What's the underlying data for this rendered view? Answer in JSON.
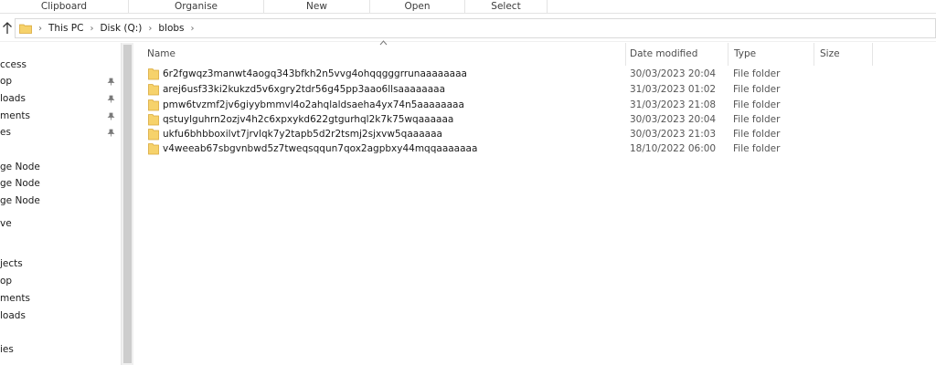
{
  "ribbon": {
    "groups": [
      "Clipboard",
      "Organise",
      "New",
      "Open",
      "Select"
    ]
  },
  "address": {
    "crumbs": [
      "This PC",
      "Disk (Q:)",
      "blobs"
    ],
    "separator": "›",
    "trailing_separator": "›"
  },
  "nav": {
    "items": [
      {
        "label": "ccess",
        "pinned": false
      },
      {
        "label": "op",
        "pinned": true
      },
      {
        "label": "loads",
        "pinned": true
      },
      {
        "label": "ments",
        "pinned": true
      },
      {
        "label": "es",
        "pinned": true
      },
      {
        "label": "ge Node",
        "pinned": false
      },
      {
        "label": "ge Node",
        "pinned": false
      },
      {
        "label": "ge Node",
        "pinned": false
      },
      {
        "label": "ve",
        "pinned": false
      },
      {
        "label": "jects",
        "pinned": false
      },
      {
        "label": "op",
        "pinned": false
      },
      {
        "label": "ments",
        "pinned": false
      },
      {
        "label": "loads",
        "pinned": false
      },
      {
        "label": "ies",
        "pinned": false
      }
    ]
  },
  "columns": {
    "name": "Name",
    "date": "Date modified",
    "type": "Type",
    "size": "Size"
  },
  "files": [
    {
      "name": "6r2fgwqz3manwt4aogq343bfkh2n5vvg4ohqqgggrrunaaaaaaaa",
      "date": "30/03/2023 20:04",
      "type": "File folder"
    },
    {
      "name": "arej6usf33ki2kukzd5v6xgry2tdr56g45pp3aao6llsaaaaaaaa",
      "date": "31/03/2023 01:02",
      "type": "File folder"
    },
    {
      "name": "pmw6tvzmf2jv6giyybmmvl4o2ahqlaldsaeha4yx74n5aaaaaaaa",
      "date": "31/03/2023 21:08",
      "type": "File folder"
    },
    {
      "name": "qstuylguhrn2ozjv4h2c6xpxykd622gtgurhql2k7k75wqaaaaaa",
      "date": "30/03/2023 20:04",
      "type": "File folder"
    },
    {
      "name": "ukfu6bhbboxilvt7jrvlqk7y2tapb5d2r2tsmj2sjxvw5qaaaaaa",
      "date": "30/03/2023 21:03",
      "type": "File folder"
    },
    {
      "name": "v4weeab67sbgvnbwd5z7tweqsqqun7qox2agpbxy44mqqaaaaaaa",
      "date": "18/10/2022 06:00",
      "type": "File folder"
    }
  ],
  "colors": {
    "folder_fill": "#f6d26b",
    "folder_tab": "#e7b53f",
    "border": "#e5e5e5"
  }
}
